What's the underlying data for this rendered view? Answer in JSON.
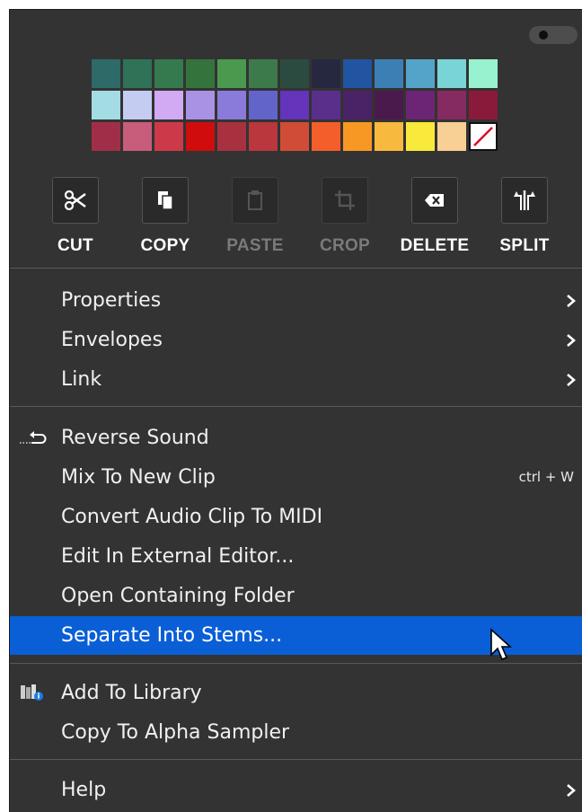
{
  "palette": {
    "rows": [
      [
        "#2e6a67",
        "#2e7258",
        "#357a4e",
        "#35733d",
        "#4b984f",
        "#3d7a4b",
        "#2c4b40",
        "#26283f",
        "#2154a1",
        "#3c7fb4",
        "#53a4c8",
        "#79d4d8",
        "#98f2cf"
      ],
      [
        "#a4dce4",
        "#c4cdf1",
        "#d1aaf3",
        "#a992e4",
        "#8a7ada",
        "#6364c9",
        "#6434ba",
        "#5a2f8c",
        "#4a2266",
        "#4a1a4d",
        "#6c2474",
        "#862a62",
        "#8a1a3a"
      ],
      [
        "#a12e48",
        "#c75d7b",
        "#cc3a4a",
        "#d10c0c",
        "#a8313f",
        "#b9373d",
        "#d14c36",
        "#f35e2a",
        "#f89824",
        "#f8ba3e",
        "#f8e93a",
        "#f8cf94",
        "none"
      ]
    ]
  },
  "tools": [
    {
      "label": "CUT",
      "icon": "scissors-icon",
      "enabled": true
    },
    {
      "label": "COPY",
      "icon": "copy-icon",
      "enabled": true
    },
    {
      "label": "PASTE",
      "icon": "clipboard-icon",
      "enabled": false
    },
    {
      "label": "CROP",
      "icon": "crop-icon",
      "enabled": false
    },
    {
      "label": "DELETE",
      "icon": "backspace-icon",
      "enabled": true
    },
    {
      "label": "SPLIT",
      "icon": "split-icon",
      "enabled": true
    }
  ],
  "menu": {
    "group1": [
      {
        "label": "Properties",
        "submenu": true
      },
      {
        "label": "Envelopes",
        "submenu": true
      },
      {
        "label": "Link",
        "submenu": true
      }
    ],
    "group2": [
      {
        "label": "Reverse Sound",
        "icon": "reverse-icon"
      },
      {
        "label": "Mix To New Clip",
        "shortcut": "ctrl + W"
      },
      {
        "label": "Convert Audio Clip To MIDI"
      },
      {
        "label": "Edit In External Editor..."
      },
      {
        "label": "Open Containing Folder"
      },
      {
        "label": "Separate Into Stems...",
        "highlighted": true
      }
    ],
    "group3": [
      {
        "label": "Add To Library",
        "icon": "library-icon"
      },
      {
        "label": "Copy To Alpha Sampler"
      }
    ],
    "group4": [
      {
        "label": "Help",
        "submenu": true
      }
    ]
  },
  "colors": {
    "menu_background": "#333333",
    "highlight": "#0a5fd6"
  }
}
